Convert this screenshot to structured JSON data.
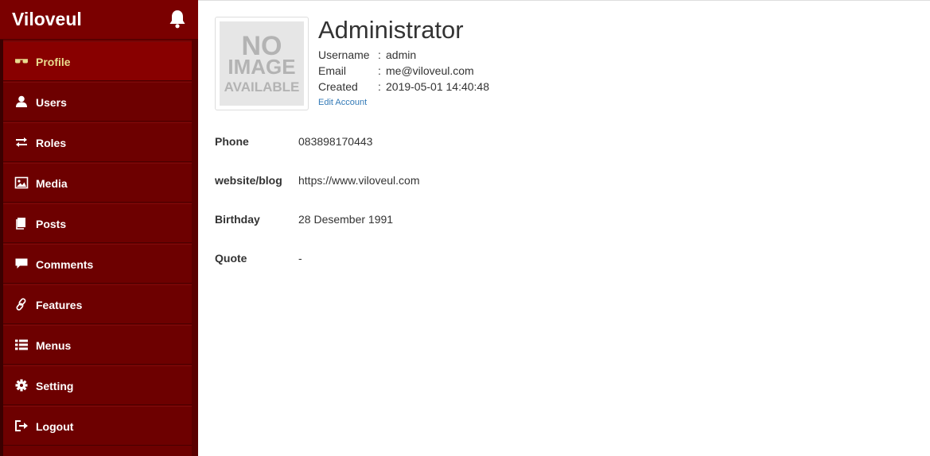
{
  "app": {
    "brand": "Viloveul",
    "notification_icon": "bell-icon"
  },
  "sidebar": {
    "items": [
      {
        "label": "Profile",
        "icon": "glasses-icon",
        "active": true
      },
      {
        "label": "Users",
        "icon": "user-icon",
        "active": false
      },
      {
        "label": "Roles",
        "icon": "exchange-icon",
        "active": false
      },
      {
        "label": "Media",
        "icon": "image-icon",
        "active": false
      },
      {
        "label": "Posts",
        "icon": "book-icon",
        "active": false
      },
      {
        "label": "Comments",
        "icon": "comment-icon",
        "active": false
      },
      {
        "label": "Features",
        "icon": "link-icon",
        "active": false
      },
      {
        "label": "Menus",
        "icon": "list-icon",
        "active": false
      },
      {
        "label": "Setting",
        "icon": "gear-icon",
        "active": false
      },
      {
        "label": "Logout",
        "icon": "logout-icon",
        "active": false
      }
    ]
  },
  "profile": {
    "avatar_text": [
      "NO",
      "IMAGE",
      "AVAILABLE"
    ],
    "name": "Administrator",
    "meta": [
      {
        "label": "Username",
        "sep": ":",
        "value": "admin"
      },
      {
        "label": "Email",
        "sep": ":",
        "value": "me@viloveul.com"
      },
      {
        "label": "Created",
        "sep": ":",
        "value": "2019-05-01 14:40:48"
      }
    ],
    "edit_link": "Edit Account",
    "details": [
      {
        "label": "Phone",
        "value": "083898170443"
      },
      {
        "label": "website/blog",
        "value": "https://www.viloveul.com"
      },
      {
        "label": "Birthday",
        "value": "28 Desember 1991"
      },
      {
        "label": "Quote",
        "value": "-"
      }
    ]
  },
  "colors": {
    "sidebar_bg": "#6d0000",
    "active_label": "#e9dc8f",
    "link": "#337ab7",
    "text": "#333333"
  }
}
